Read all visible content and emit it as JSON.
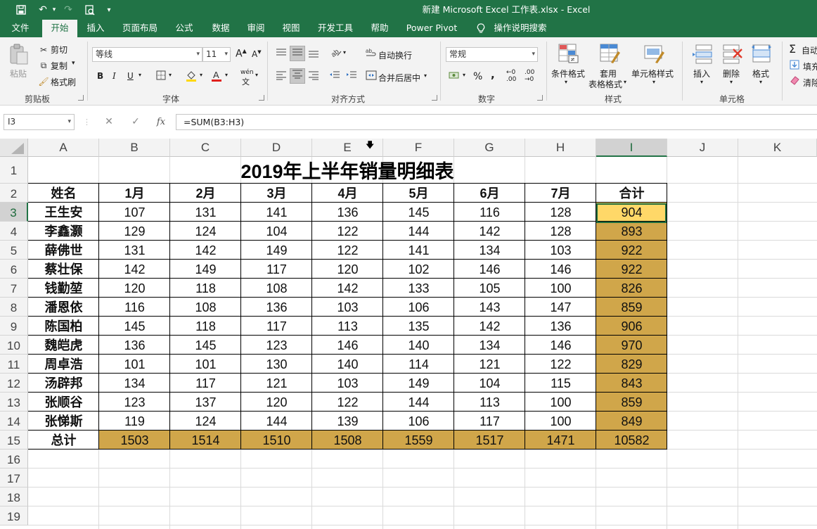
{
  "window": {
    "title": "新建 Microsoft Excel 工作表.xlsx  -  Excel"
  },
  "tabs": [
    "文件",
    "开始",
    "插入",
    "页面布局",
    "公式",
    "数据",
    "审阅",
    "视图",
    "开发工具",
    "帮助",
    "Power Pivot",
    "操作说明搜索"
  ],
  "active_tab": "开始",
  "ribbon": {
    "clipboard": {
      "paste": "粘贴",
      "cut": "剪切",
      "copy": "复制",
      "format_painter": "格式刷",
      "label": "剪贴板"
    },
    "font": {
      "name": "等线",
      "size": "11",
      "label": "字体",
      "grow": "A",
      "shrink": "A",
      "bold": "B",
      "italic": "I",
      "underline": "U",
      "phonetic": "wén"
    },
    "alignment": {
      "wrap": "自动换行",
      "merge": "合并后居中",
      "label": "对齐方式"
    },
    "number": {
      "format": "常规",
      "label": "数字",
      "percent": "%",
      "comma": ",",
      "inc_decimal": "←0 .00",
      "dec_decimal": ".00 →0"
    },
    "styles": {
      "conditional": "条件格式",
      "table_line1": "套用",
      "table_line2": "表格格式",
      "cell_styles": "单元格样式",
      "label": "样式"
    },
    "cells": {
      "insert": "插入",
      "delete": "删除",
      "format": "格式",
      "label": "单元格"
    },
    "editing": {
      "autosum": "自动",
      "fill": "填充",
      "clear": "清除"
    }
  },
  "formula_bar": {
    "name_box": "I3",
    "formula": "=SUM(B3:H3)",
    "fx": "fx",
    "cancel": "✕",
    "enter": "✓"
  },
  "sheet": {
    "columns": [
      "A",
      "B",
      "C",
      "D",
      "E",
      "F",
      "G",
      "H",
      "I",
      "J",
      "K"
    ],
    "selected_column": "I",
    "rows": [
      "1",
      "2",
      "3",
      "4",
      "5",
      "6",
      "7",
      "8",
      "9",
      "10",
      "11",
      "12",
      "13",
      "14",
      "15",
      "16",
      "17",
      "18",
      "19"
    ],
    "selected_row": "3",
    "title": "2019年上半年销量明细表",
    "header": [
      "姓名",
      "1月",
      "2月",
      "3月",
      "4月",
      "5月",
      "6月",
      "7月",
      "合计"
    ],
    "data": [
      [
        "王生安",
        "107",
        "131",
        "141",
        "136",
        "145",
        "116",
        "128",
        "904"
      ],
      [
        "李鑫灏",
        "129",
        "124",
        "104",
        "122",
        "144",
        "142",
        "128",
        "893"
      ],
      [
        "薛佛世",
        "131",
        "142",
        "149",
        "122",
        "141",
        "134",
        "103",
        "922"
      ],
      [
        "蔡壮保",
        "142",
        "149",
        "117",
        "120",
        "102",
        "146",
        "146",
        "922"
      ],
      [
        "钱勤堃",
        "120",
        "118",
        "108",
        "142",
        "133",
        "105",
        "100",
        "826"
      ],
      [
        "潘恩依",
        "116",
        "108",
        "136",
        "103",
        "106",
        "143",
        "147",
        "859"
      ],
      [
        "陈国柏",
        "145",
        "118",
        "117",
        "113",
        "135",
        "142",
        "136",
        "906"
      ],
      [
        "魏皑虎",
        "136",
        "145",
        "123",
        "146",
        "140",
        "134",
        "146",
        "970"
      ],
      [
        "周卓浩",
        "101",
        "101",
        "130",
        "140",
        "114",
        "121",
        "122",
        "829"
      ],
      [
        "汤辟邦",
        "134",
        "117",
        "121",
        "103",
        "149",
        "104",
        "115",
        "843"
      ],
      [
        "张顺谷",
        "123",
        "137",
        "120",
        "122",
        "144",
        "113",
        "100",
        "859"
      ],
      [
        "张悌斯",
        "119",
        "124",
        "144",
        "139",
        "106",
        "117",
        "100",
        "849"
      ]
    ],
    "total": [
      "总计",
      "1503",
      "1514",
      "1510",
      "1508",
      "1559",
      "1517",
      "1471",
      "10582"
    ]
  },
  "colors": {
    "excel_green": "#217346",
    "total_highlight": "#d0a64a",
    "selected_cell": "#ffd868"
  }
}
